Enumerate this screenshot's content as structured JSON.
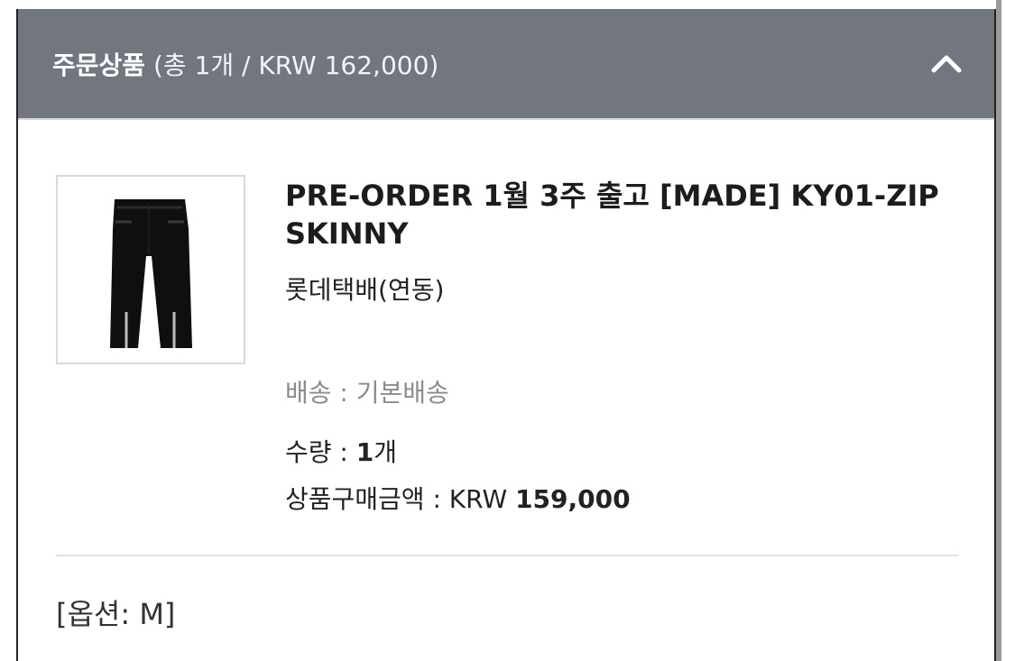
{
  "order_items": {
    "header": {
      "title": "주문상품",
      "summary": "(총 1개 / KRW 162,000)"
    },
    "item": {
      "name": "PRE-ORDER 1월 3주 출고 [MADE] KY01-ZIP SKINNY",
      "shipping_company": "롯데택배(연동)",
      "delivery_label": "배송",
      "delivery_separator": " : ",
      "delivery_value": "기본배송",
      "quantity_label": "수량",
      "quantity_separator": " : ",
      "quantity_value": "1",
      "quantity_unit": "개",
      "price_label": "상품구매금액",
      "price_separator": " : ",
      "price_currency": "KRW",
      "price_value": "159,000",
      "option": "[옵션: M]"
    }
  },
  "colors": {
    "header_bg": "#72767f",
    "header_text": "#ffffff",
    "accent_text": "#1c1c1c",
    "muted_text": "#8b8b8b"
  },
  "icons": {
    "collapse": "chevron-up-icon",
    "product": "jeans-product-image"
  }
}
